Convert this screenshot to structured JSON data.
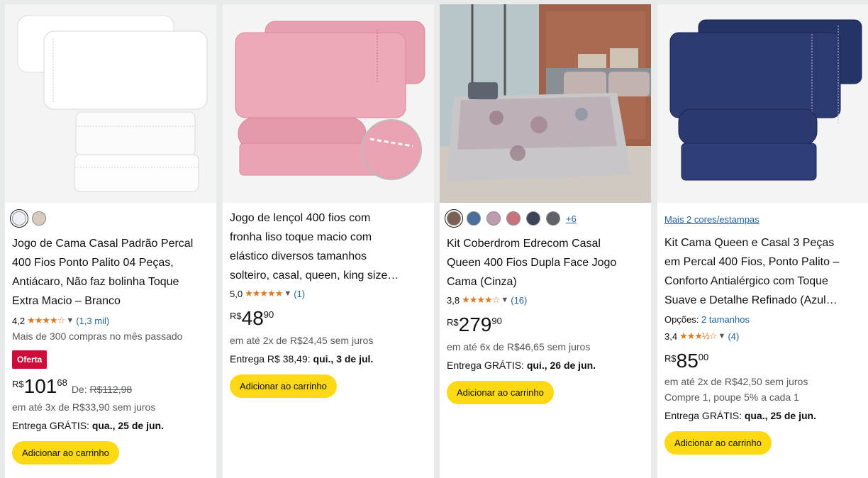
{
  "products": [
    {
      "title": "Jogo de Cama Casal Padrão Percal 400 Fios Ponto Palito 04 Peças, Antiácaro, Não faz bolinha Toque Extra Macio – Branco",
      "title_lines": [
        "Jogo de Cama Casal Padrão Percal",
        "400 Fios Ponto Palito 04 Peças,",
        "Antiácaro, Não faz bolinha Toque",
        "Extra Macio – Branco"
      ],
      "swatches": [
        "#eef0f6",
        "#d8cbbd"
      ],
      "rating": "4,2",
      "stars": "★★★★☆",
      "rating_count": "(1,3 mil)",
      "bought": "Mais de 300 compras no mês passado",
      "badge": "Oferta",
      "price_currency": "R$",
      "price_whole": "101",
      "price_fraction": "68",
      "was_label": "De:",
      "was_price": "R$112,98",
      "installments": "em até 3x de R$33,90 sem juros",
      "delivery_prefix": "Entrega GRÁTIS:",
      "delivery_date": "qua., 25 de jun.",
      "button": "Adicionar ao carrinho"
    },
    {
      "title_lines": [
        "Jogo de lençol 400 fios com",
        "fronha liso toque macio com",
        "elástico diversos tamanhos",
        "solteiro, casal, queen, king size…"
      ],
      "rating": "5,0",
      "stars": "★★★★★",
      "rating_count": "(1)",
      "price_currency": "R$",
      "price_whole": "48",
      "price_fraction": "90",
      "installments": "em até 2x de R$24,45 sem juros",
      "delivery_prefix": "Entrega R$ 38,49:",
      "delivery_date": "qui., 3 de jul.",
      "button": "Adicionar ao carrinho"
    },
    {
      "title_lines": [
        "Kit Coberdrom Edrecom Casal",
        "Queen 400 Fios Dupla Face Jogo",
        "Cama (Cinza)"
      ],
      "swatches": [
        "#7b5f52",
        "#4a6f99",
        "#c09bb0",
        "#c8737c",
        "#3c4458",
        "#5f6368"
      ],
      "more_swatches": "+6",
      "rating": "3,8",
      "stars": "★★★★☆",
      "rating_count": "(16)",
      "price_currency": "R$",
      "price_whole": "279",
      "price_fraction": "90",
      "installments": "em até 6x de R$46,65 sem juros",
      "delivery_prefix": "Entrega GRÁTIS:",
      "delivery_date": "qui., 26 de jun.",
      "button": "Adicionar ao carrinho"
    },
    {
      "more_colors": "Mais 2 cores/estampas",
      "title_lines": [
        "Kit Cama Queen e Casal 3 Peças",
        "em Percal 400 Fios, Ponto Palito –",
        "Conforto Antialérgico com Toque",
        "Suave e Detalhe Refinado (Azul…"
      ],
      "options_label": "Opções:",
      "options_value": "2 tamanhos",
      "rating": "3,4",
      "stars": "★★★½☆",
      "rating_count": "(4)",
      "price_currency": "R$",
      "price_whole": "85",
      "price_fraction": "00",
      "installments": "em até 2x de R$42,50 sem juros",
      "promo": "Compre 1, poupe 5% a cada 1",
      "delivery_prefix": "Entrega GRÁTIS:",
      "delivery_date": "qua., 25 de jun.",
      "button": "Adicionar ao carrinho"
    }
  ],
  "colors": {
    "link": "#2162a1",
    "star": "#de7921",
    "deal": "#cc0c39",
    "button": "#ffd814"
  }
}
